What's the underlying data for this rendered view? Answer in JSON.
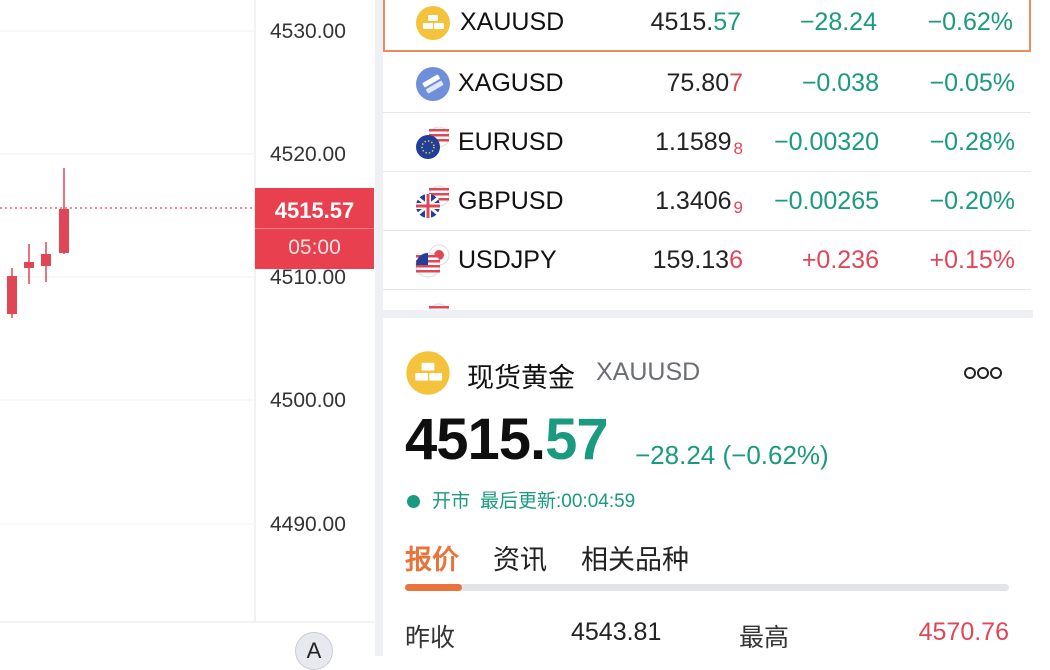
{
  "chart": {
    "axis_labels": [
      "4530.00",
      "4520.00",
      "4510.00",
      "4500.00",
      "4490.00"
    ],
    "current_price": "4515.57",
    "countdown": "05:00",
    "scale_button": "A",
    "colors": {
      "up": "#1a9a7f",
      "down": "#e14656",
      "tag": "#e8404f"
    }
  },
  "watchlist": [
    {
      "symbol": "XAUUSD",
      "last_main": "4515.",
      "last_tail": "57",
      "last_tail_dir": "green",
      "change": "−28.24",
      "change_pct": "−0.62%",
      "dir": "green",
      "icon": "gold-bar-icon",
      "selected": true
    },
    {
      "symbol": "XAGUSD",
      "last_main": "75.80",
      "last_tail": "7",
      "last_tail_dir": "red",
      "change": "−0.038",
      "change_pct": "−0.05%",
      "dir": "green",
      "icon": "silver-bar-icon",
      "selected": false
    },
    {
      "symbol": "EURUSD",
      "last_main": "1.1589",
      "last_tail": "8",
      "last_tail_dir": "red",
      "change": "−0.00320",
      "change_pct": "−0.28%",
      "dir": "green",
      "icon": "eu-us-flag-icon",
      "selected": false
    },
    {
      "symbol": "GBPUSD",
      "last_main": "1.3406",
      "last_tail": "9",
      "last_tail_dir": "red",
      "change": "−0.00265",
      "change_pct": "−0.20%",
      "dir": "green",
      "icon": "uk-us-flag-icon",
      "selected": false
    },
    {
      "symbol": "USDJPY",
      "last_main": "159.13",
      "last_tail": "6",
      "last_tail_dir": "red",
      "change": "+0.236",
      "change_pct": "+0.15%",
      "dir": "red",
      "icon": "us-jp-flag-icon",
      "selected": false
    }
  ],
  "detail": {
    "icon": "gold-bar-icon",
    "name": "现货黄金",
    "symbol": "XAUUSD",
    "more_icon": "more-dots-icon",
    "price_int": "4515.",
    "price_dec": "57",
    "change": "−28.24 (−0.62%)",
    "status": "开市",
    "last_update": "最后更新:00:04:59",
    "tabs": [
      "报价",
      "资讯",
      "相关品种"
    ],
    "stats": {
      "prev_close_label": "昨收",
      "prev_close": "4543.81",
      "high_label": "最高",
      "high": "4570.76"
    }
  }
}
